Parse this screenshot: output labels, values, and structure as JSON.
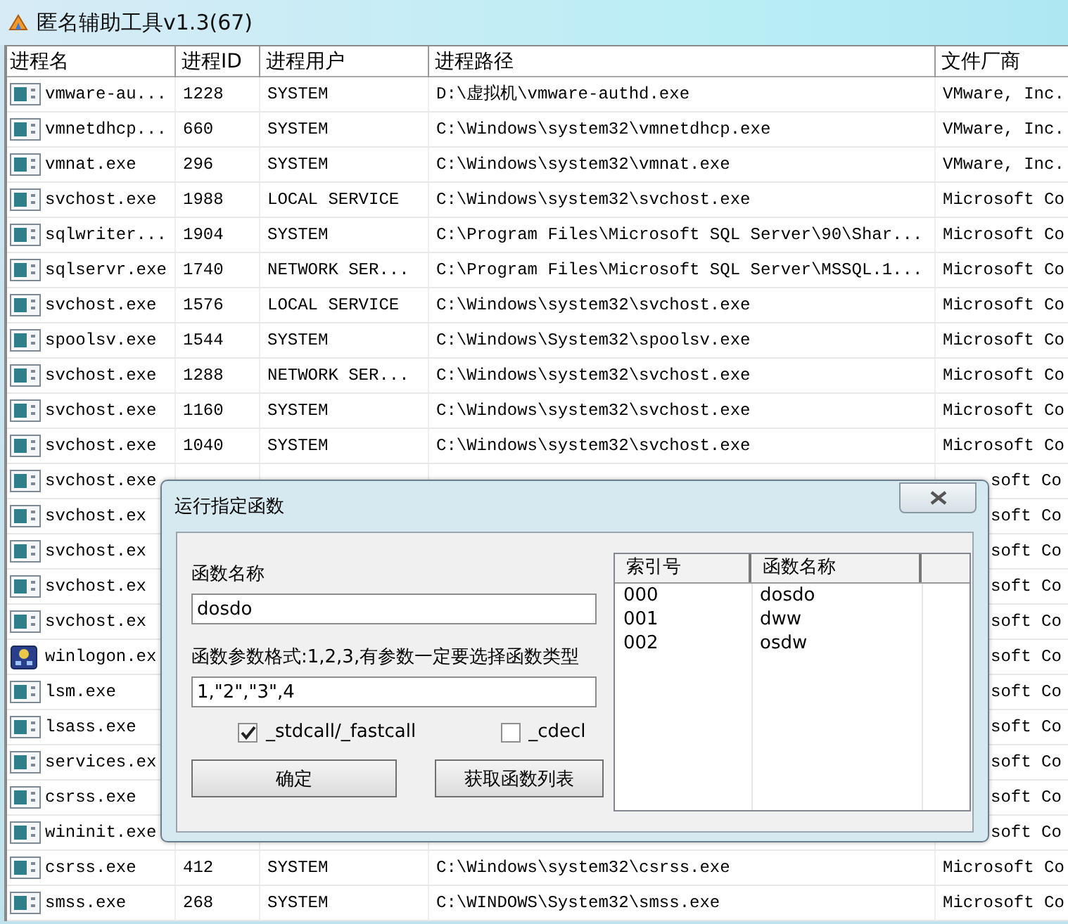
{
  "window": {
    "title": "匿名辅助工具v1.3(67)"
  },
  "table": {
    "columns": [
      "进程名",
      "进程ID",
      "进程用户",
      "进程路径",
      "文件厂商"
    ],
    "rows": [
      {
        "name": "vmware-au...",
        "id": "1228",
        "user": "SYSTEM",
        "path": "D:\\虚拟机\\vmware-authd.exe",
        "vendor": "VMware, Inc."
      },
      {
        "name": "vmnetdhcp...",
        "id": "660",
        "user": "SYSTEM",
        "path": "C:\\Windows\\system32\\vmnetdhcp.exe",
        "vendor": "VMware, Inc."
      },
      {
        "name": "vmnat.exe",
        "id": "296",
        "user": "SYSTEM",
        "path": "C:\\Windows\\system32\\vmnat.exe",
        "vendor": "VMware, Inc."
      },
      {
        "name": "svchost.exe",
        "id": "1988",
        "user": "LOCAL SERVICE",
        "path": "C:\\Windows\\system32\\svchost.exe",
        "vendor": "Microsoft Co"
      },
      {
        "name": "sqlwriter...",
        "id": "1904",
        "user": "SYSTEM",
        "path": "C:\\Program Files\\Microsoft SQL Server\\90\\Shar...",
        "vendor": "Microsoft Co"
      },
      {
        "name": "sqlservr.exe",
        "id": "1740",
        "user": "NETWORK SER...",
        "path": "C:\\Program Files\\Microsoft SQL Server\\MSSQL.1...",
        "vendor": "Microsoft Co"
      },
      {
        "name": "svchost.exe",
        "id": "1576",
        "user": "LOCAL SERVICE",
        "path": "C:\\Windows\\system32\\svchost.exe",
        "vendor": "Microsoft Co"
      },
      {
        "name": "spoolsv.exe",
        "id": "1544",
        "user": "SYSTEM",
        "path": "C:\\Windows\\System32\\spoolsv.exe",
        "vendor": "Microsoft Co"
      },
      {
        "name": "svchost.exe",
        "id": "1288",
        "user": "NETWORK SER...",
        "path": "C:\\Windows\\system32\\svchost.exe",
        "vendor": "Microsoft Co"
      },
      {
        "name": "svchost.exe",
        "id": "1160",
        "user": "SYSTEM",
        "path": "C:\\Windows\\system32\\svchost.exe",
        "vendor": "Microsoft Co"
      },
      {
        "name": "svchost.exe",
        "id": "1040",
        "user": "SYSTEM",
        "path": "C:\\Windows\\system32\\svchost.exe",
        "vendor": "Microsoft Co"
      },
      {
        "name": "svchost.exe",
        "vendor": "soft Co"
      },
      {
        "name": "svchost.ex",
        "vendor": "soft Co"
      },
      {
        "name": "svchost.ex",
        "vendor": "soft Co"
      },
      {
        "name": "svchost.ex",
        "vendor": "soft Co"
      },
      {
        "name": "svchost.ex",
        "vendor": "soft Co"
      },
      {
        "kind": "winlogon",
        "name": "winlogon.ex",
        "vendor": "soft Co"
      },
      {
        "name": "lsm.exe",
        "vendor": "soft Co"
      },
      {
        "name": "lsass.exe",
        "vendor": "soft Co"
      },
      {
        "name": "services.ex",
        "vendor": "soft Co"
      },
      {
        "name": "csrss.exe",
        "vendor": "soft Co"
      },
      {
        "name": "wininit.exe",
        "vendor": "soft Co"
      },
      {
        "name": "csrss.exe",
        "id": "412",
        "user": "SYSTEM",
        "path": "C:\\Windows\\system32\\csrss.exe",
        "vendor": "Microsoft Co"
      },
      {
        "name": "smss.exe",
        "id": "268",
        "user": "SYSTEM",
        "path": "C:\\WINDOWS\\System32\\smss.exe",
        "vendor": "Microsoft Co"
      }
    ]
  },
  "dialog": {
    "title": "运行指定函数",
    "fields": [
      {
        "label": "函数名称",
        "value": "dosdo"
      },
      {
        "label": "函数参数格式:1,2,3,有参数一定要选择函数类型",
        "value": "1,\"2\",\"3\",4"
      }
    ],
    "checkboxes": [
      {
        "label": "_stdcall/_fastcall",
        "checked": true
      },
      {
        "label": "_cdecl",
        "checked": false
      }
    ],
    "buttons": [
      "确定",
      "获取函数列表"
    ],
    "list": {
      "columns": [
        "索引号",
        "函数名称"
      ],
      "rows": [
        [
          "000",
          "dosdo"
        ],
        [
          "001",
          "dww"
        ],
        [
          "002",
          "osdw"
        ]
      ]
    }
  }
}
